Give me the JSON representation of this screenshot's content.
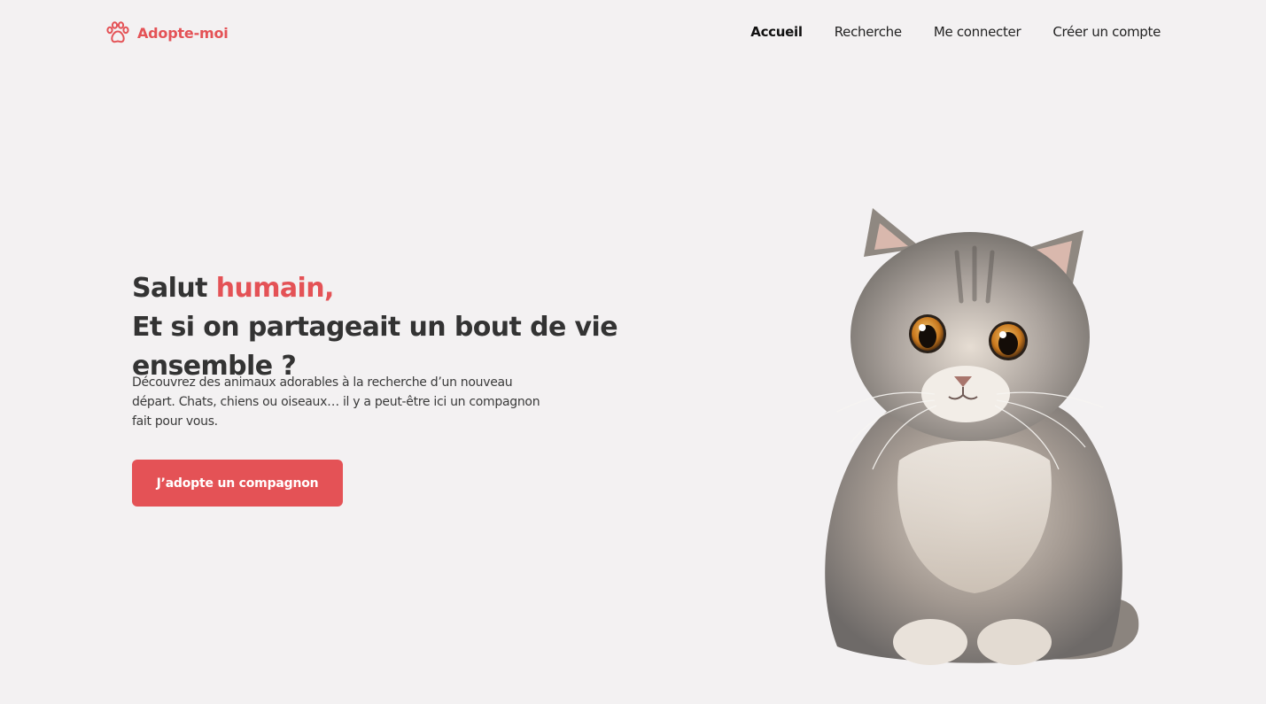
{
  "header": {
    "logo_text": "Adopte-moi",
    "logo_icon": "paw-icon",
    "nav": [
      {
        "label": "Accueil",
        "active": true
      },
      {
        "label": "Recherche",
        "active": false
      },
      {
        "label": "Me connecter",
        "active": false
      },
      {
        "label": "Créer un compte",
        "active": false
      }
    ]
  },
  "hero": {
    "title_prefix": "Salut ",
    "title_accent": "humain,",
    "title_line2": "Et si on partageait un bout de vie ensemble ?",
    "description": "Découvrez des animaux adorables à la recherche d’un nouveau départ. Chats, chiens ou oiseaux… il y a peut-être ici un compagnon fait pour vous.",
    "cta_label": "J’adopte un compagnon"
  },
  "colors": {
    "accent": "#e45256",
    "background": "#f3f1f2",
    "text": "#333333"
  }
}
